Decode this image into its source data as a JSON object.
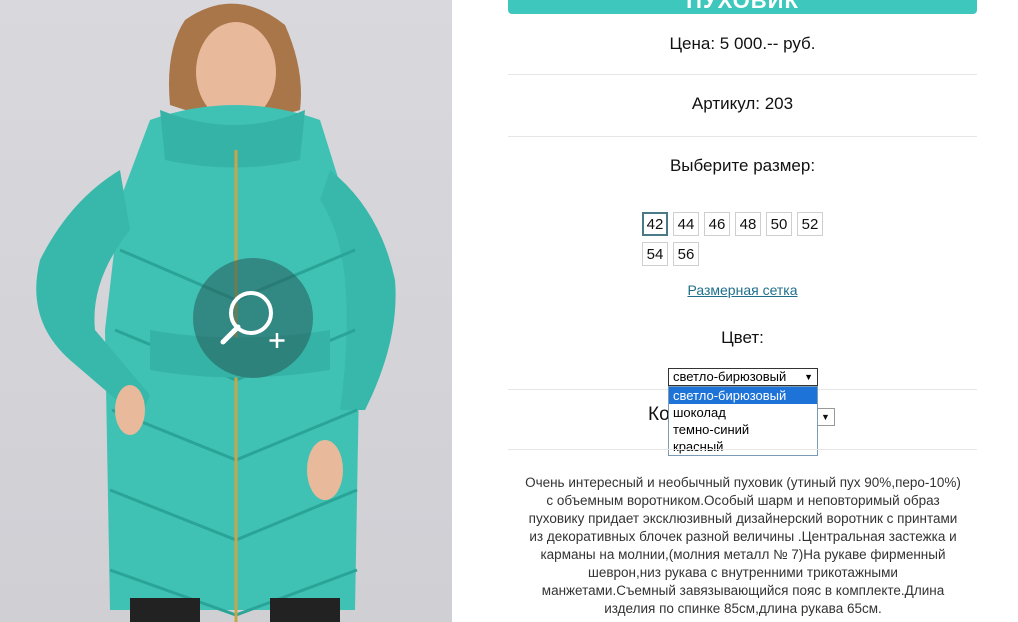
{
  "product": {
    "title": "ПУХОВИК",
    "price": "Цена: 5 000.-- руб.",
    "article": "Артикул: 203",
    "size_prompt": "Выберите размер:",
    "sizes": [
      "42",
      "44",
      "46",
      "48",
      "50",
      "52",
      "54",
      "56"
    ],
    "selected_size": "42",
    "size_chart_link": "Размерная сетка",
    "color_label": "Цвет:",
    "color_selected": "светло-бирюзовый",
    "color_options": [
      "светло-бирюзовый",
      "шоколад",
      "темно-синий",
      "красный"
    ],
    "quantity_label_partial": "Ко",
    "description": "Очень интересный и необычный пуховик (утиный пух 90%,перо-10%) с объемным воротником.Особый шарм и неповторимый образ пуховику придает эксклюзивный дизайнерский воротник с принтами из декоративных блочек разной величины .Центральная застежка и карманы на молнии,(молния металл № 7)На рукаве фирменный шеврон,низ рукава с внутренними трикотажными манжетами.Съемный завязывающийся пояс в комплекте.Длина изделия по спинке 85см,длина рукава 65см."
  },
  "colors": {
    "accent": "#3ec7bc",
    "link": "#1f6f8b",
    "dropdown_highlight": "#1e73d8",
    "coat": "#3fc2b4"
  },
  "icons": {
    "zoom": "magnifier-plus-icon"
  }
}
